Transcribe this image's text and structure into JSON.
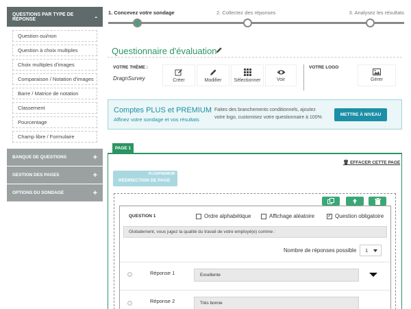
{
  "sidebar": {
    "header": "QUESTIONS PAR TYPE DE RÉPONSE",
    "header_sign": "-",
    "items": [
      {
        "label": "Question oui/non"
      },
      {
        "label": "Question à choix multiples"
      },
      {
        "label": "Choix multiples d'images"
      },
      {
        "label": "Comparaison / Notation d'images"
      },
      {
        "label": "Barre / Matrice de notation"
      },
      {
        "label": "Classement"
      },
      {
        "label": "Pourcentage"
      },
      {
        "label": "Champ libre / Formulaire"
      }
    ],
    "sections": [
      {
        "label": "BANQUE DE QUESTIONS",
        "sign": "+"
      },
      {
        "label": "GESTION DES PAGES",
        "sign": "+"
      },
      {
        "label": "OPTIONS DU SONDAGE",
        "sign": "+"
      }
    ]
  },
  "steps": [
    {
      "label": "1. Concevez votre sondage",
      "active": true
    },
    {
      "label": "2. Collectez des réponses",
      "active": false
    },
    {
      "label": "3. Analysez les résultats",
      "active": false
    }
  ],
  "survey": {
    "title": "Questionnaire d'évaluation"
  },
  "theme": {
    "label": "VOTRE THÈME :",
    "name": "DragnSurvey",
    "buttons": {
      "create": "Créer",
      "edit": "Modifier",
      "select": "Sélectionner",
      "view": "Voir"
    }
  },
  "logo": {
    "label": "VOTRE LOGO",
    "manage": "Gérer"
  },
  "promo": {
    "title": "Comptes PLUS et PREMIUM",
    "subtitle": "Affinez votre sondage et vos résultats",
    "text": "Faites des branchements conditionnels, ajoutez votre logo, customisez votre questionnaire à 100%",
    "button": "METTRE À NIVEAU"
  },
  "page": {
    "tab": "PAGE 1",
    "erase": "EFFACER CETTE PAGE",
    "redirect_badge": "PLUS/PREMIUM",
    "redirect_label": "REDIRECTION DE PAGE"
  },
  "question": {
    "number": "QUESTION 1",
    "options": {
      "alpha": "Ordre alphabétique",
      "random": "Affichage aléatoire",
      "required": "Question obligatoire"
    },
    "text": "Globalement, vous jugez la qualité du travail de votre employé(e) comme :",
    "count_label": "Nombre de réponses possible",
    "count_value": "1",
    "answers": [
      {
        "label": "Réponse 1",
        "value": "Excellente"
      },
      {
        "label": "Réponse 2",
        "value": "Très bonne"
      }
    ]
  },
  "colors": {
    "accent": "#2a9462",
    "promo": "#1c8fa6",
    "sidebar_head": "#5f6a6a",
    "sidebar_section": "#9ba1a1"
  },
  "icons": [
    "pencil-icon",
    "plus-icon",
    "pencil-alt-icon",
    "grid-icon",
    "eye-icon",
    "image-icon",
    "copy-icon",
    "recycle-icon",
    "trash-icon",
    "chevron-down-icon"
  ]
}
